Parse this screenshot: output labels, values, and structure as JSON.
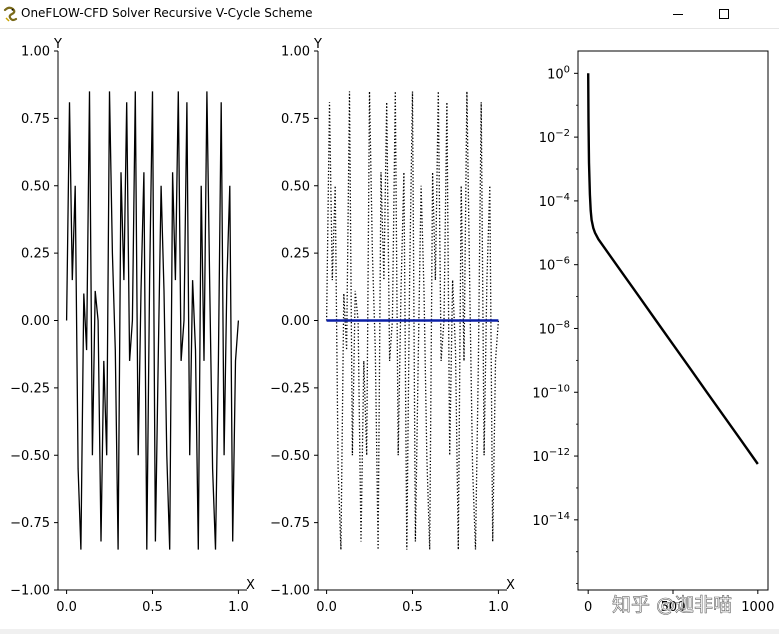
{
  "window": {
    "title": "OneFLOW-CFD Solver Recursive V-Cycle Scheme",
    "icon": "python-snake-icon",
    "buttons": {
      "minimize": "minimize-icon",
      "maximize": "maximize-icon"
    }
  },
  "watermark": "知乎 @迦非喵",
  "colors": {
    "line": "#000000",
    "zero_line": "#0a1fa5",
    "frame": "#000000"
  },
  "chart_data": [
    {
      "type": "line",
      "title": "",
      "xlabel": "X",
      "ylabel": "Y",
      "xlim": [
        -0.05,
        1.05
      ],
      "ylim": [
        -1.0,
        1.0
      ],
      "xticks": [
        "0.0",
        "0.5",
        "1.0"
      ],
      "xtick_values": [
        0.0,
        0.5,
        1.0
      ],
      "yticks": [
        "1.00",
        "0.75",
        "0.50",
        "0.25",
        "0.00",
        "−0.25",
        "−0.50",
        "−0.75",
        "−1.00"
      ],
      "ytick_values": [
        1.0,
        0.75,
        0.5,
        0.25,
        0.0,
        -0.25,
        -0.5,
        -0.75,
        -1.0
      ],
      "frame": "left-bottom",
      "series": [
        {
          "style": "solid",
          "x": [
            0.0,
            0.0167,
            0.0333,
            0.05,
            0.0667,
            0.0833,
            0.1,
            0.1167,
            0.1333,
            0.15,
            0.1667,
            0.1833,
            0.2,
            0.2167,
            0.2333,
            0.25,
            0.2667,
            0.2833,
            0.3,
            0.3167,
            0.3333,
            0.35,
            0.3667,
            0.3833,
            0.4,
            0.4167,
            0.4333,
            0.45,
            0.4667,
            0.4833,
            0.5,
            0.5167,
            0.5333,
            0.55,
            0.5667,
            0.5833,
            0.6,
            0.6167,
            0.6333,
            0.65,
            0.6667,
            0.6833,
            0.7,
            0.7167,
            0.7333,
            0.75,
            0.7667,
            0.7833,
            0.8,
            0.8167,
            0.8333,
            0.85,
            0.8667,
            0.8833,
            0.9,
            0.9167,
            0.9333,
            0.95,
            0.9667,
            0.9833,
            1.0
          ],
          "y": [
            0.0,
            0.81,
            0.15,
            0.5,
            -0.55,
            -0.85,
            0.1,
            -0.11,
            0.85,
            -0.5,
            0.11,
            0.0,
            -0.82,
            -0.15,
            -0.5,
            0.85,
            0.25,
            -0.11,
            -0.85,
            0.55,
            0.15,
            0.81,
            -0.15,
            0.0,
            0.85,
            -0.5,
            0.11,
            0.55,
            -0.85,
            0.15,
            0.85,
            -0.82,
            -0.15,
            0.5,
            0.11,
            -0.5,
            -0.85,
            0.55,
            0.15,
            0.85,
            -0.15,
            0.0,
            0.81,
            -0.5,
            0.15,
            -0.11,
            -0.85,
            0.5,
            -0.15,
            0.85,
            0.11,
            -0.55,
            -0.85,
            -0.15,
            0.81,
            -0.5,
            0.15,
            0.5,
            -0.82,
            -0.15,
            0.0
          ]
        }
      ]
    },
    {
      "type": "line",
      "title": "",
      "xlabel": "X",
      "ylabel": "Y",
      "xlim": [
        -0.05,
        1.05
      ],
      "ylim": [
        -1.0,
        1.0
      ],
      "xticks": [
        "0.0",
        "0.5",
        "1.0"
      ],
      "xtick_values": [
        0.0,
        0.5,
        1.0
      ],
      "yticks": [
        "1.00",
        "0.75",
        "0.50",
        "0.25",
        "0.00",
        "−0.25",
        "−0.50",
        "−0.75",
        "−1.00"
      ],
      "ytick_values": [
        1.0,
        0.75,
        0.5,
        0.25,
        0.0,
        -0.25,
        -0.5,
        -0.75,
        -1.0
      ],
      "frame": "left-bottom",
      "series": [
        {
          "style": "dotted",
          "x": [
            0.0,
            0.0167,
            0.0333,
            0.05,
            0.0667,
            0.0833,
            0.1,
            0.1167,
            0.1333,
            0.15,
            0.1667,
            0.1833,
            0.2,
            0.2167,
            0.2333,
            0.25,
            0.2667,
            0.2833,
            0.3,
            0.3167,
            0.3333,
            0.35,
            0.3667,
            0.3833,
            0.4,
            0.4167,
            0.4333,
            0.45,
            0.4667,
            0.4833,
            0.5,
            0.5167,
            0.5333,
            0.55,
            0.5667,
            0.5833,
            0.6,
            0.6167,
            0.6333,
            0.65,
            0.6667,
            0.6833,
            0.7,
            0.7167,
            0.7333,
            0.75,
            0.7667,
            0.7833,
            0.8,
            0.8167,
            0.8333,
            0.85,
            0.8667,
            0.8833,
            0.9,
            0.9167,
            0.9333,
            0.95,
            0.9667,
            0.9833,
            1.0
          ],
          "y": [
            0.0,
            0.81,
            0.15,
            0.5,
            -0.55,
            -0.85,
            0.1,
            -0.11,
            0.85,
            -0.5,
            0.11,
            0.0,
            -0.82,
            -0.15,
            -0.5,
            0.85,
            0.25,
            -0.11,
            -0.85,
            0.55,
            0.15,
            0.81,
            -0.15,
            0.0,
            0.85,
            -0.5,
            0.11,
            0.55,
            -0.85,
            0.15,
            0.85,
            -0.82,
            -0.15,
            0.5,
            0.11,
            -0.5,
            -0.85,
            0.55,
            0.15,
            0.85,
            -0.15,
            0.0,
            0.81,
            -0.5,
            0.15,
            -0.11,
            -0.85,
            0.5,
            -0.15,
            0.85,
            0.11,
            -0.55,
            -0.85,
            -0.15,
            0.81,
            -0.5,
            0.15,
            0.5,
            -0.82,
            -0.15,
            0.0
          ]
        },
        {
          "style": "solid-thick",
          "color_key": "zero_line",
          "x": [
            0.0,
            1.0
          ],
          "y": [
            0.0,
            0.0
          ]
        }
      ]
    },
    {
      "type": "line",
      "title": "",
      "xlabel": "",
      "ylabel": "",
      "yscale": "log",
      "xlim": [
        -60,
        1060
      ],
      "ylim_log10": [
        -16.2,
        0.7
      ],
      "xticks": [
        "0",
        "500",
        "1000"
      ],
      "xtick_values": [
        0,
        500,
        1000
      ],
      "yticks_mantissa": [
        "10",
        "10",
        "10",
        "10",
        "10",
        "10",
        "10",
        "10"
      ],
      "yticks_exponent": [
        "0",
        "−2",
        "−4",
        "−6",
        "−8",
        "−10",
        "−12",
        "−14"
      ],
      "ytick_values_log10": [
        0,
        -2,
        -4,
        -6,
        -8,
        -10,
        -12,
        -14
      ],
      "frame": "box",
      "series": [
        {
          "style": "solid",
          "x": [
            0,
            2,
            5,
            10,
            15,
            20,
            30,
            40,
            60,
            100,
            200,
            300,
            400,
            500,
            600,
            700,
            800,
            900,
            1000
          ],
          "log10_y": [
            0.0,
            -1.5,
            -2.8,
            -3.8,
            -4.3,
            -4.6,
            -4.85,
            -5.0,
            -5.2,
            -5.5,
            -6.25,
            -7.0,
            -7.75,
            -8.5,
            -9.25,
            -10.0,
            -10.75,
            -11.5,
            -12.25
          ]
        }
      ]
    }
  ]
}
